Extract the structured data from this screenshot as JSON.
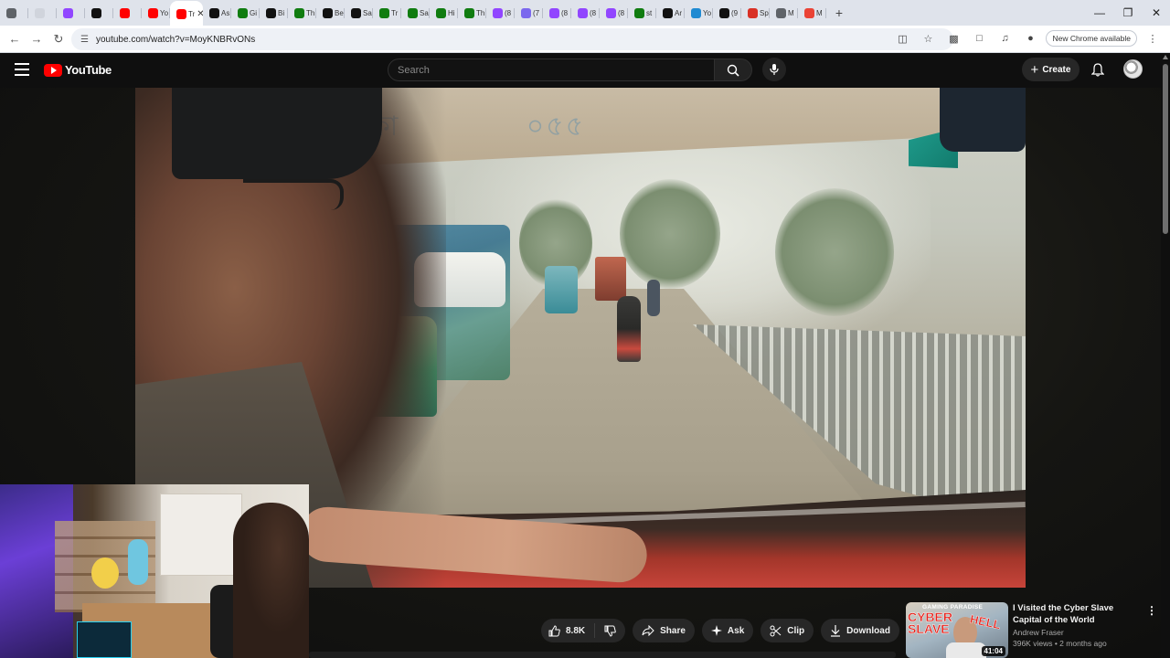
{
  "browser": {
    "tabs": [
      {
        "icon": "chrome-icon",
        "label": "",
        "color": "#5f6368"
      },
      {
        "icon": "blank-icon",
        "label": "",
        "color": "#d0d4dc"
      },
      {
        "icon": "twitch-icon",
        "label": "",
        "color": "#9146ff"
      },
      {
        "icon": "kick-icon",
        "label": "",
        "color": "#111111"
      },
      {
        "icon": "youtube-icon",
        "label": "",
        "color": "#ff0000"
      },
      {
        "icon": "youtube-icon",
        "label": "Yo",
        "color": "#ff0000"
      },
      {
        "icon": "youtube-icon",
        "label": "Tr",
        "color": "#ff0000"
      },
      {
        "icon": "kick-icon",
        "label": "As",
        "color": "#111111"
      },
      {
        "icon": "xbox-icon",
        "label": "Gi",
        "color": "#107c10"
      },
      {
        "icon": "kick-icon",
        "label": "Bi",
        "color": "#111111"
      },
      {
        "icon": "xbox-icon",
        "label": "Th",
        "color": "#107c10"
      },
      {
        "icon": "kick-icon",
        "label": "Be",
        "color": "#111111"
      },
      {
        "icon": "kick-icon",
        "label": "Sa",
        "color": "#111111"
      },
      {
        "icon": "xbox-icon",
        "label": "Tr",
        "color": "#107c10"
      },
      {
        "icon": "xbox-icon",
        "label": "Sa",
        "color": "#107c10"
      },
      {
        "icon": "xbox-icon",
        "label": "Hi",
        "color": "#107c10"
      },
      {
        "icon": "xbox-icon",
        "label": "Th",
        "color": "#107c10"
      },
      {
        "icon": "twitch-icon",
        "label": "(8",
        "color": "#9146ff"
      },
      {
        "icon": "copilot-icon",
        "label": "(7",
        "color": "#7b68ee"
      },
      {
        "icon": "twitch-icon",
        "label": "(8",
        "color": "#9146ff"
      },
      {
        "icon": "twitch-icon",
        "label": "(8",
        "color": "#9146ff"
      },
      {
        "icon": "twitch-icon",
        "label": "(8",
        "color": "#9146ff"
      },
      {
        "icon": "xbox-icon",
        "label": "st",
        "color": "#107c10"
      },
      {
        "icon": "kick-icon",
        "label": "Ar",
        "color": "#111111"
      },
      {
        "icon": "edge-icon",
        "label": "Yo",
        "color": "#1f8ad2"
      },
      {
        "icon": "threads-icon",
        "label": "(9",
        "color": "#111111"
      },
      {
        "icon": "stop-icon",
        "label": "Sp",
        "color": "#d93025"
      },
      {
        "icon": "globe-icon",
        "label": "M",
        "color": "#5f6368"
      },
      {
        "icon": "gmail-icon",
        "label": "M",
        "color": "#ea4335"
      }
    ],
    "active_tab_index": 6,
    "url": "youtube.com/watch?v=MoyKNBRvONs",
    "new_chrome": "New Chrome available"
  },
  "youtube": {
    "logo_text": "YouTube",
    "search_placeholder": "Search",
    "create_label": "Create"
  },
  "actions": {
    "like_count": "8.8K",
    "share": "Share",
    "ask": "Ask",
    "clip": "Clip",
    "download": "Download"
  },
  "recommended": {
    "title": "I Visited the Cyber Slave Capital of the World",
    "channel": "Andrew Fraser",
    "stats": "396K views • 2 months ago",
    "duration": "41:04",
    "thumb_banner": "GAMING PARADISE",
    "thumb_text_1": "CYBER SLAVE",
    "thumb_text_2": "HELL"
  },
  "colors": {
    "brand_red": "#ff0000",
    "page_bg": "#0f0f0f",
    "pill_bg": "#272727"
  }
}
